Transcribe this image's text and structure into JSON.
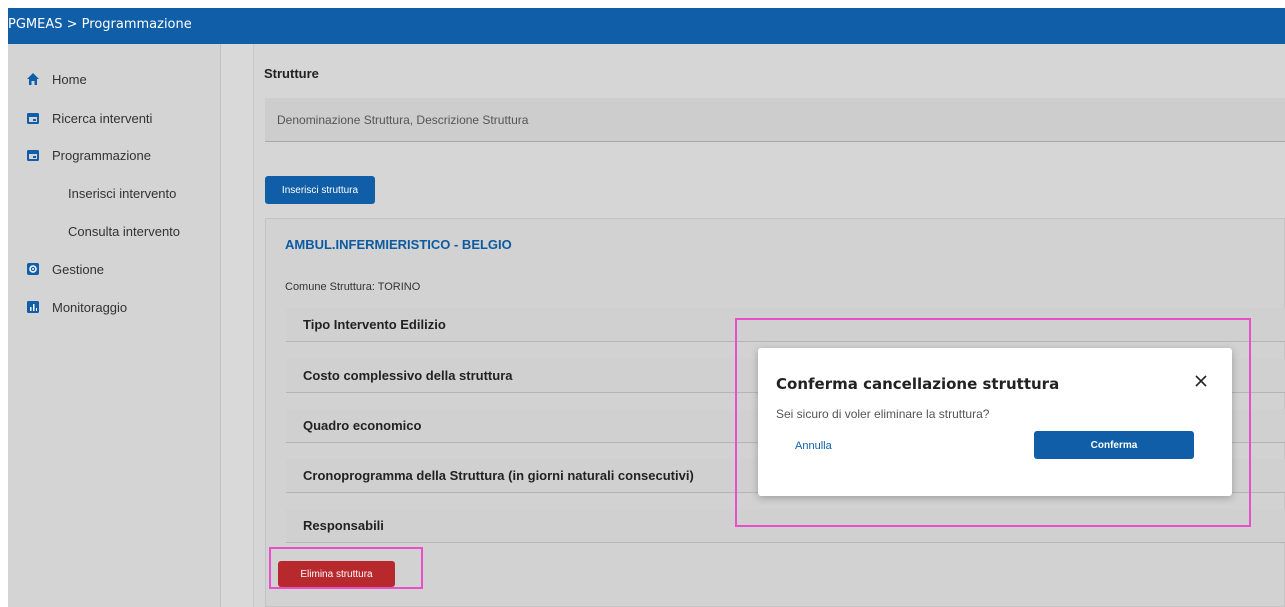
{
  "header": {
    "breadcrumb": "PGMEAS > Programmazione"
  },
  "sidebar": {
    "items": [
      {
        "label": "Home",
        "icon": "home-icon"
      },
      {
        "label": "Ricerca interventi",
        "icon": "calendar-icon"
      },
      {
        "label": "Programmazione",
        "icon": "calendar-icon"
      },
      {
        "label": "Gestione",
        "icon": "gear-icon"
      },
      {
        "label": "Monitoraggio",
        "icon": "bar-chart-icon"
      }
    ],
    "subitems": [
      "Inserisci intervento",
      "Consulta intervento"
    ]
  },
  "main": {
    "title": "Strutture",
    "search_placeholder": "Denominazione Struttura, Descrizione Struttura",
    "insert_button": "Inserisci struttura",
    "card": {
      "title": "AMBUL.INFERMIERISTICO - BELGIO",
      "comune": "Comune Struttura: TORINO",
      "sections": [
        "Tipo Intervento Edilizio",
        "Costo complessivo della struttura",
        "Quadro economico",
        "Cronoprogramma della Struttura (in giorni naturali consecutivi)",
        "Responsabili"
      ],
      "delete_button": "Elimina struttura"
    }
  },
  "modal": {
    "title": "Conferma cancellazione struttura",
    "message": "Sei sicuro di voler eliminare la struttura?",
    "cancel": "Annulla",
    "confirm": "Conferma"
  },
  "colors": {
    "primary": "#0f5ea7",
    "danger": "#b8292e",
    "highlight": "#e84fc9"
  }
}
